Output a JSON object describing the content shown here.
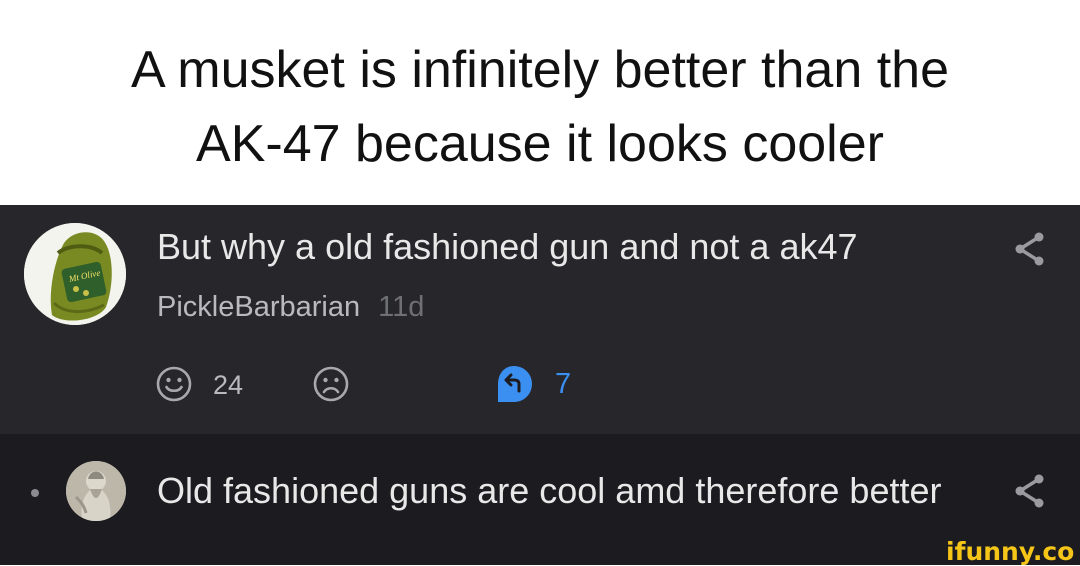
{
  "caption": {
    "line1": "A musket is infinitely better than the",
    "line2": "AK-47 because it looks cooler"
  },
  "comment1": {
    "text": "But why a old fashioned gun and not a ak47",
    "username": "PickleBarbarian",
    "time": "11d",
    "smiles": "24",
    "replies": "7",
    "avatar_label": "Mt Olive",
    "share_icon": "share-icon",
    "smile_icon": "smile-icon",
    "frown_icon": "frown-icon",
    "reply_icon": "reply-icon"
  },
  "comment2": {
    "text": "Old fashioned guns are cool amd therefore better",
    "share_icon": "share-icon"
  },
  "watermark": {
    "text": "ifunny.co"
  },
  "colors": {
    "panel_bg": "#26262b",
    "reply_bg": "#1c1c20",
    "reply_accent": "#3b8ff0",
    "watermark": "#f5c518"
  }
}
